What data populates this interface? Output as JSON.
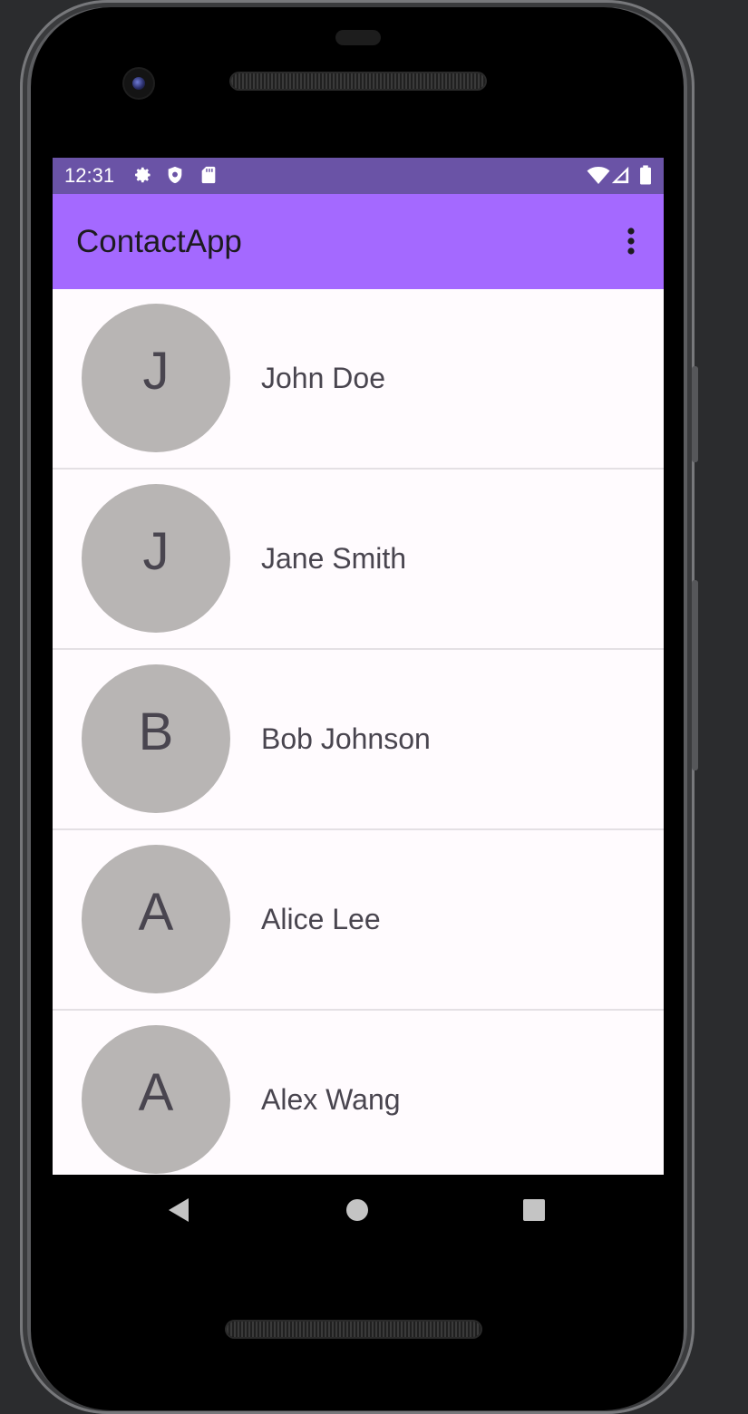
{
  "status_bar": {
    "time": "12:31",
    "icons": [
      "gear-icon",
      "shield-icon",
      "sd-card-icon",
      "wifi-icon",
      "cell-signal-icon",
      "battery-icon"
    ],
    "background": "#6a53a6"
  },
  "app_bar": {
    "title": "ContactApp",
    "overflow_icon": "more-vert-icon",
    "background": "#a469ff"
  },
  "contacts": [
    {
      "initial": "J",
      "name": "John Doe"
    },
    {
      "initial": "J",
      "name": "Jane Smith"
    },
    {
      "initial": "B",
      "name": "Bob Johnson"
    },
    {
      "initial": "A",
      "name": "Alice Lee"
    },
    {
      "initial": "A",
      "name": "Alex Wang"
    }
  ],
  "colors": {
    "screen_background": "#fffbfe",
    "avatar": "#b8b5b4",
    "text": "#49454f",
    "divider": "#e4e0e4"
  },
  "nav_bar": {
    "icons": [
      "back-icon",
      "home-icon",
      "recents-icon"
    ]
  }
}
